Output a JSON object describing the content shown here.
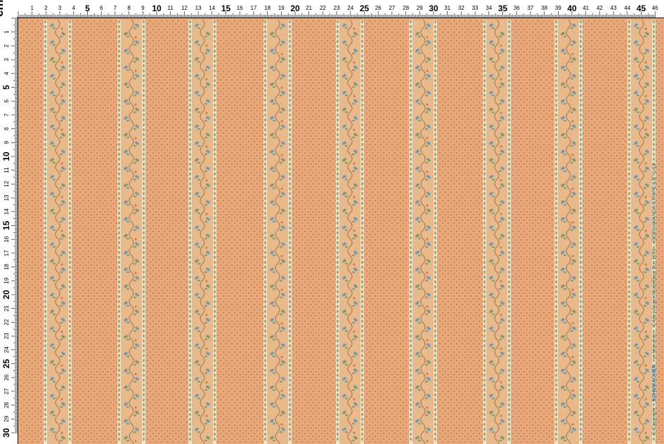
{
  "ruler": {
    "unit": "cm",
    "top_labels": [
      "1",
      "2",
      "3",
      "4",
      "5",
      "6",
      "7",
      "8",
      "9",
      "10",
      "11",
      "12",
      "13",
      "14",
      "15",
      "16",
      "17",
      "18",
      "19",
      "20",
      "21",
      "22",
      "23",
      "24",
      "25",
      "26",
      "27",
      "28",
      "29",
      "30",
      "31",
      "32",
      "33",
      "34",
      "35",
      "36",
      "37",
      "38",
      "39",
      "40",
      "41",
      "42",
      "43",
      "44",
      "45",
      "46"
    ],
    "left_labels": [
      "1",
      "2",
      "3",
      "4",
      "5",
      "6",
      "7",
      "8",
      "9",
      "10",
      "11",
      "12",
      "13",
      "14",
      "15",
      "16",
      "17",
      "18",
      "19",
      "20",
      "21",
      "22",
      "23",
      "24",
      "25",
      "26",
      "27",
      "28",
      "29",
      "30"
    ]
  },
  "print_info": {
    "copyright": "© Copyright",
    "brand": "SCHUMACHER",
    "brand_suffix": "in München",
    "maker": "© Mini Anger-Modellbau Co. 1979",
    "product": "#9026 AMANDA STRIPE 1/2\" 1:18"
  },
  "colors": {
    "background": "#e9a878",
    "dot": "#a86a4f",
    "band_light": "#f4e4c6",
    "leaf_blue": "#6f9bb8",
    "leaf_green": "#7d9b78",
    "vine": "#b07e4f",
    "ruler_bg": "#ffffff",
    "ruler_ink": "#000000"
  }
}
